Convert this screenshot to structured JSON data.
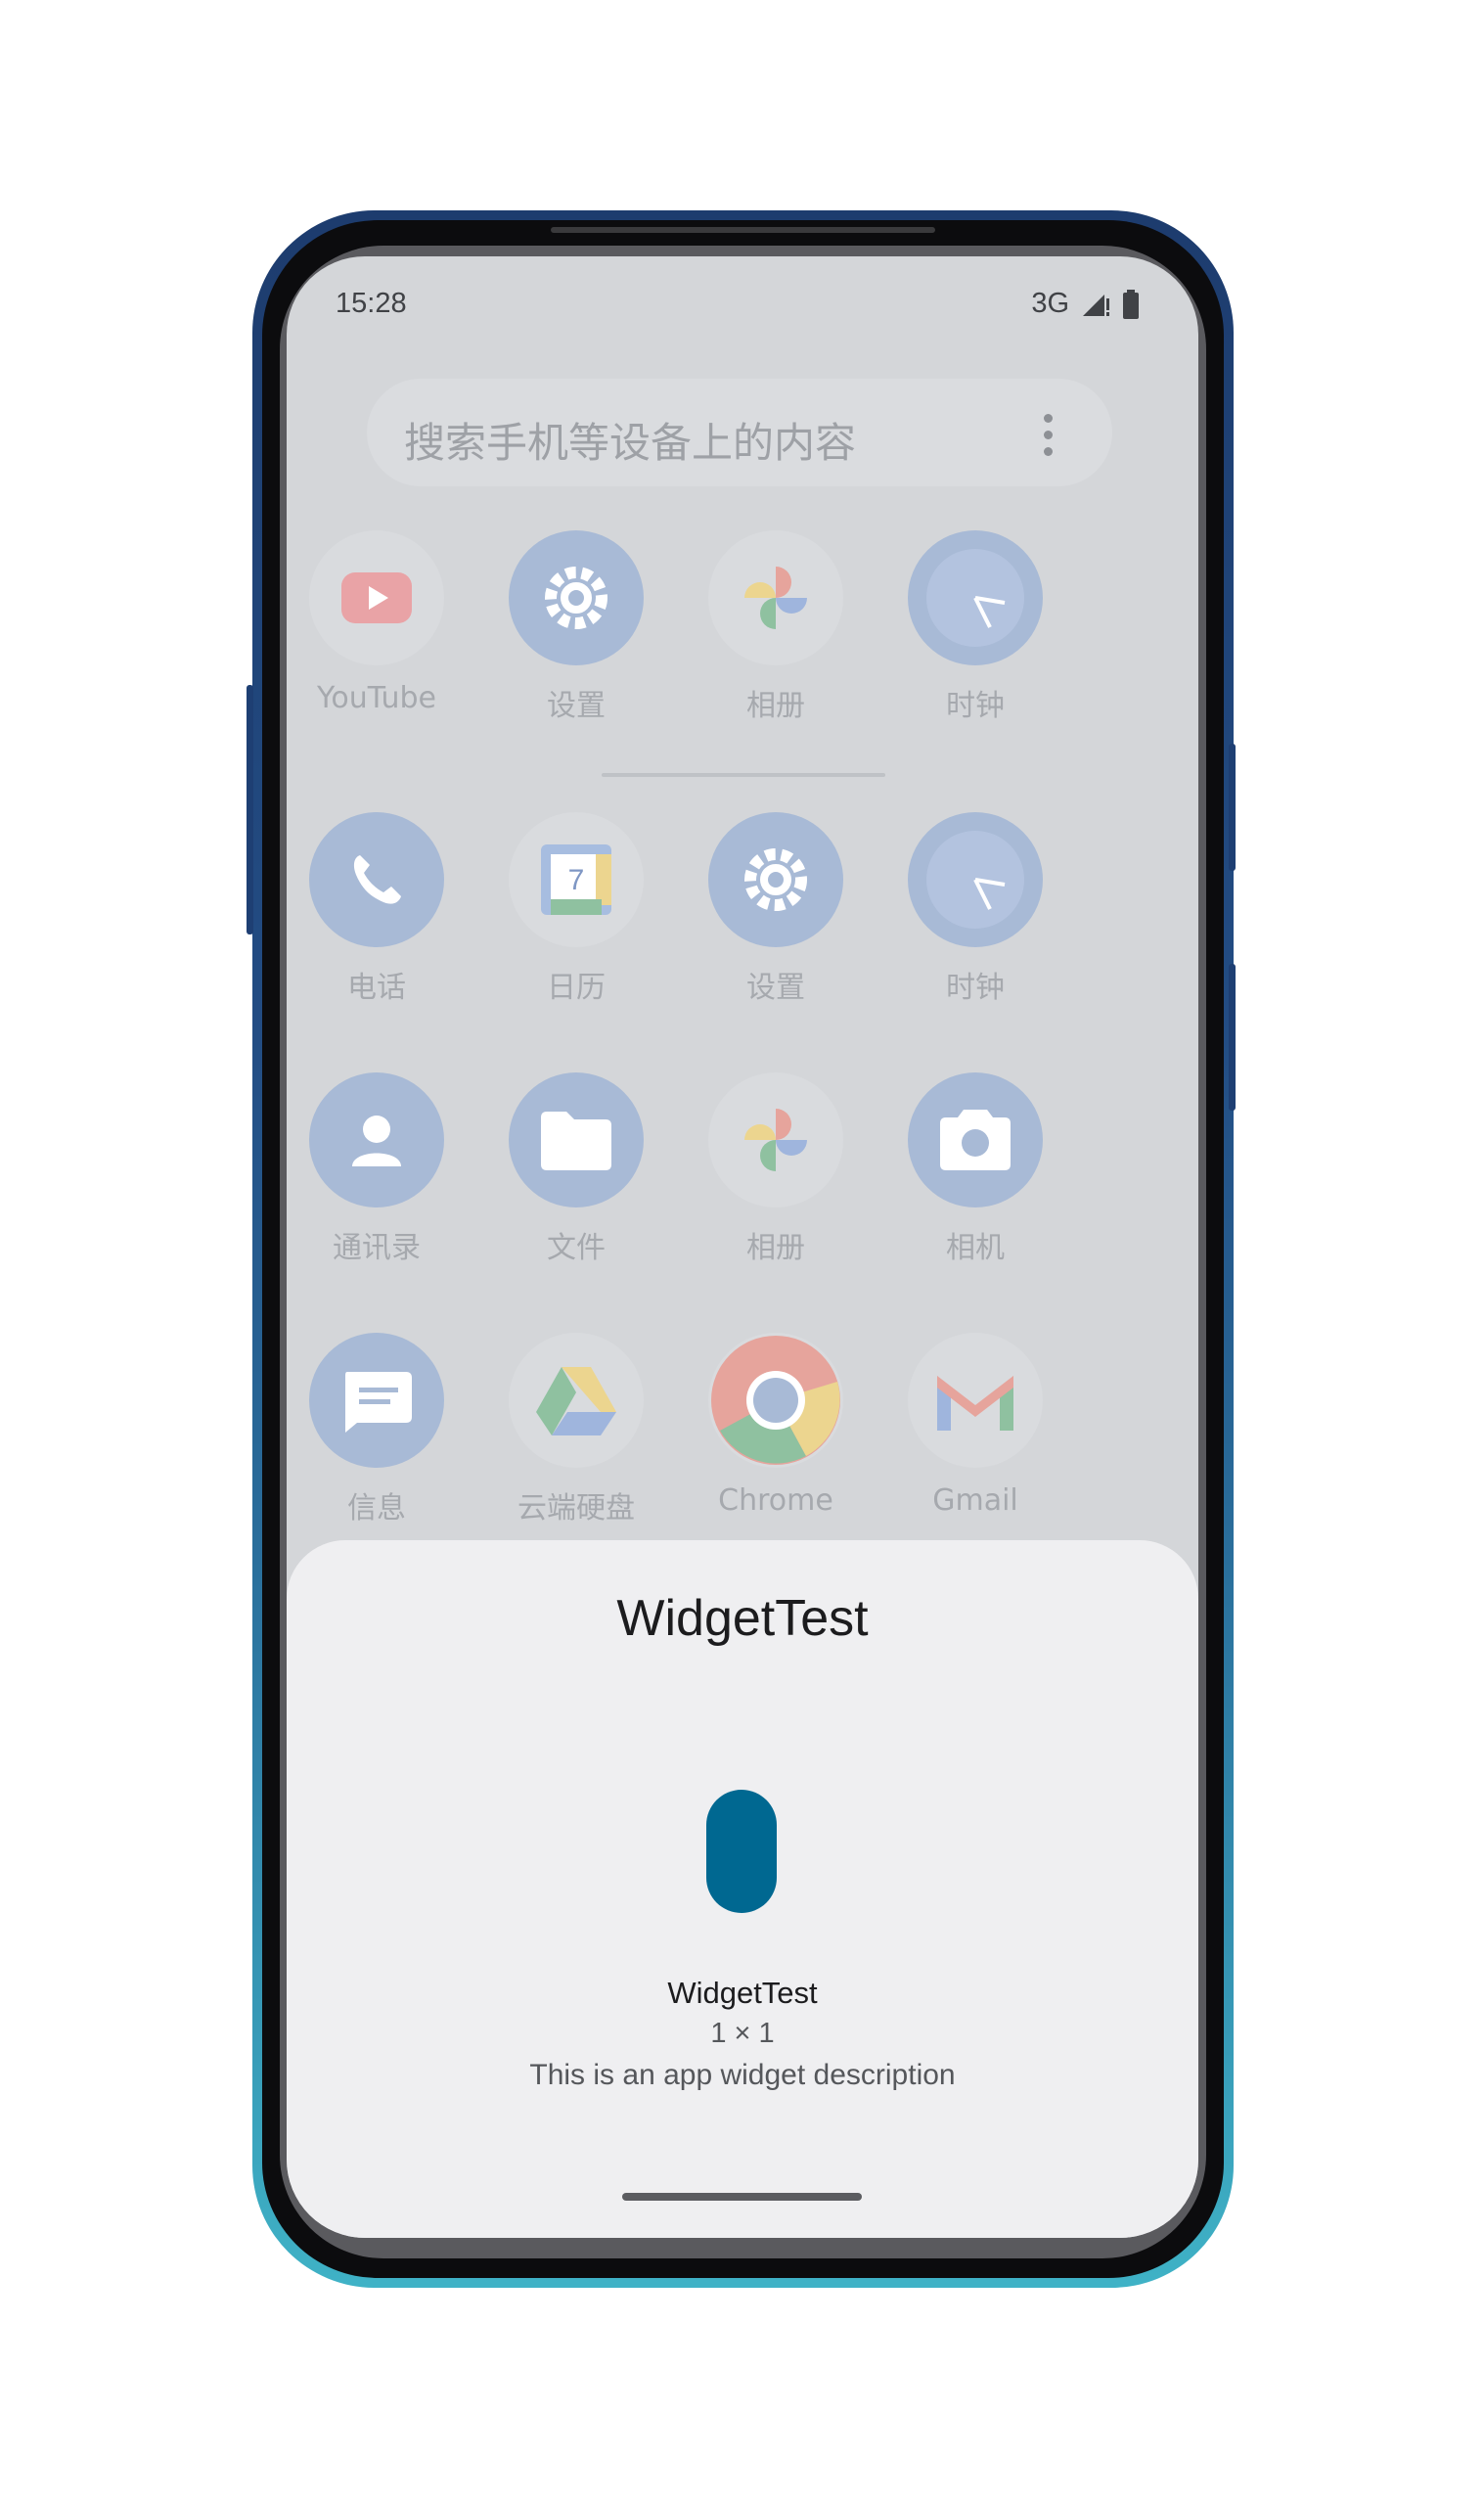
{
  "status_bar": {
    "time": "15:28",
    "network": "3G",
    "signal_icon": "signal-icon",
    "battery_icon": "battery-icon"
  },
  "search": {
    "placeholder": "搜索手机等设备上的内容",
    "menu_icon": "more-vert-icon"
  },
  "apps": [
    {
      "label": "YouTube",
      "icon": "youtube-icon"
    },
    {
      "label": "设置",
      "icon": "settings-icon"
    },
    {
      "label": "相册",
      "icon": "photos-icon"
    },
    {
      "label": "时钟",
      "icon": "clock-icon"
    },
    {
      "label": "电话",
      "icon": "phone-icon"
    },
    {
      "label": "日历",
      "icon": "calendar-icon"
    },
    {
      "label": "设置",
      "icon": "settings-icon"
    },
    {
      "label": "时钟",
      "icon": "clock-icon"
    },
    {
      "label": "通讯录",
      "icon": "contacts-icon"
    },
    {
      "label": "文件",
      "icon": "files-icon"
    },
    {
      "label": "相册",
      "icon": "photos-icon"
    },
    {
      "label": "相机",
      "icon": "camera-icon"
    },
    {
      "label": "信息",
      "icon": "messages-icon"
    },
    {
      "label": "云端硬盘",
      "icon": "drive-icon"
    },
    {
      "label": "Chrome",
      "icon": "chrome-icon"
    },
    {
      "label": "Gmail",
      "icon": "gmail-icon"
    }
  ],
  "calendar_day": "7",
  "sheet": {
    "title": "WidgetTest",
    "widget_name": "WidgetTest",
    "widget_size": "1 × 1",
    "widget_description": "This is an app widget description"
  },
  "colors": {
    "widget_preview": "#006891",
    "sheet_background": "#efeff1",
    "scrim": "#d4d6d9"
  }
}
